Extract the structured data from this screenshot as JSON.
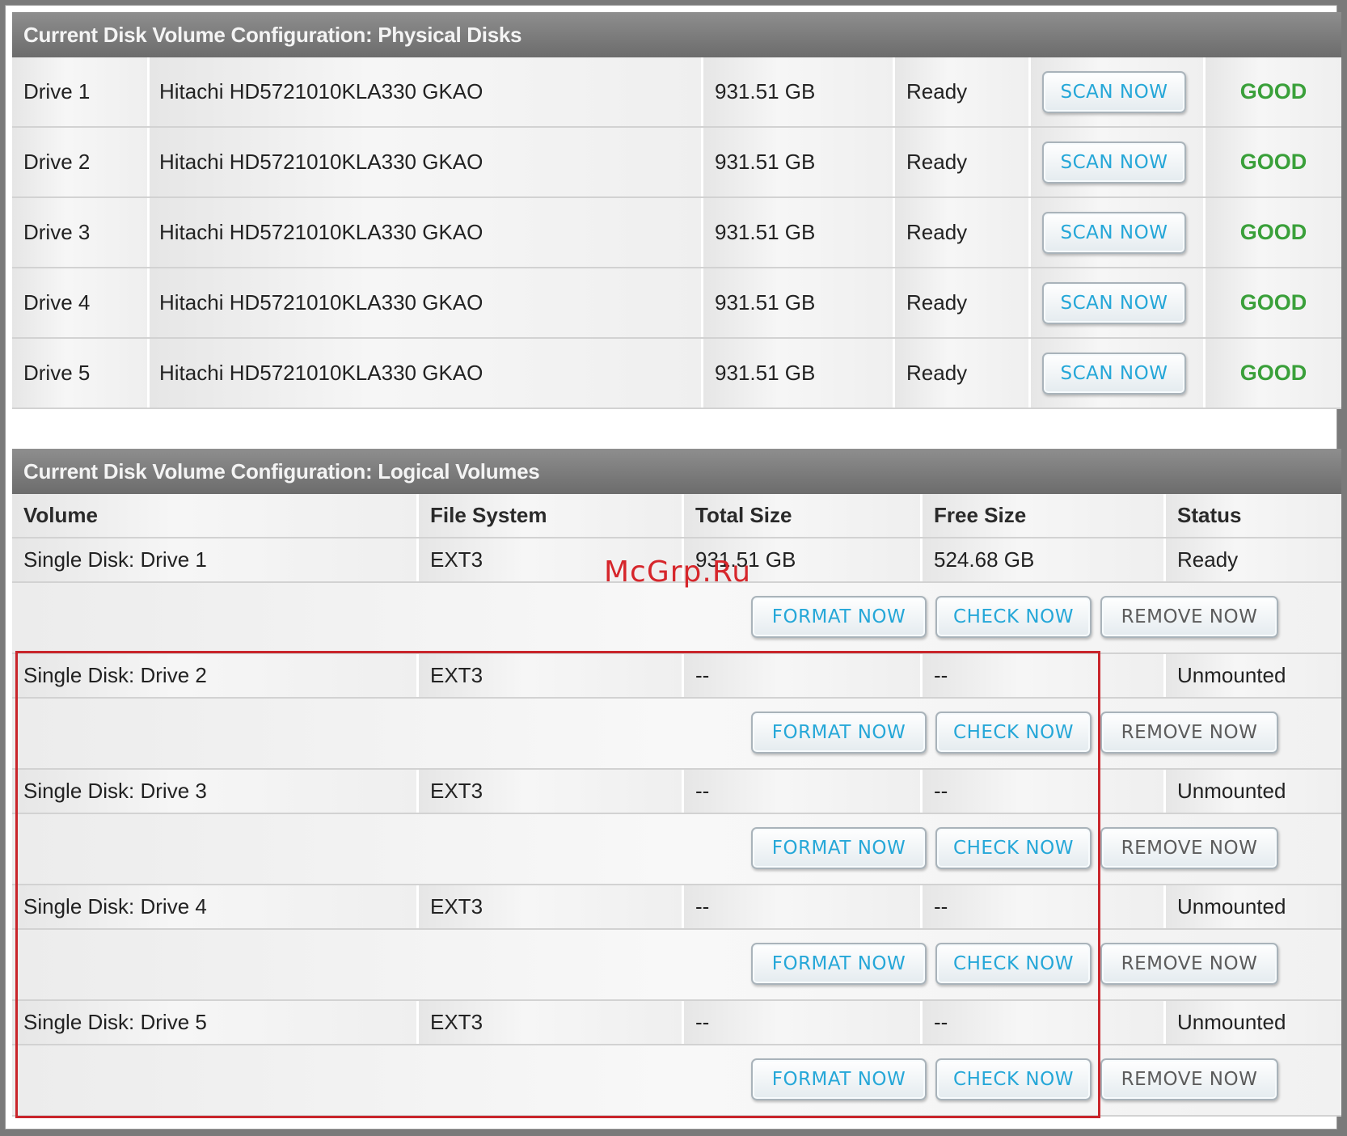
{
  "physical": {
    "title": "Current Disk Volume Configuration: Physical Disks",
    "drives": [
      {
        "name": "Drive 1",
        "model": "Hitachi HD5721010KLA330 GKAO",
        "size": "931.51 GB",
        "state": "Ready",
        "action": "SCAN NOW",
        "health": "GOOD"
      },
      {
        "name": "Drive 2",
        "model": "Hitachi HD5721010KLA330 GKAO",
        "size": "931.51 GB",
        "state": "Ready",
        "action": "SCAN NOW",
        "health": "GOOD"
      },
      {
        "name": "Drive 3",
        "model": "Hitachi HD5721010KLA330 GKAO",
        "size": "931.51 GB",
        "state": "Ready",
        "action": "SCAN NOW",
        "health": "GOOD"
      },
      {
        "name": "Drive 4",
        "model": "Hitachi HD5721010KLA330 GKAO",
        "size": "931.51 GB",
        "state": "Ready",
        "action": "SCAN NOW",
        "health": "GOOD"
      },
      {
        "name": "Drive 5",
        "model": "Hitachi HD5721010KLA330 GKAO",
        "size": "931.51 GB",
        "state": "Ready",
        "action": "SCAN NOW",
        "health": "GOOD"
      }
    ]
  },
  "logical": {
    "title": "Current Disk Volume Configuration: Logical Volumes",
    "headers": {
      "volume": "Volume",
      "fs": "File System",
      "total": "Total Size",
      "free": "Free Size",
      "status": "Status"
    },
    "volumes": [
      {
        "volume": "Single Disk: Drive 1",
        "fs": "EXT3",
        "total": "931.51 GB",
        "free": "524.68 GB",
        "status": "Ready"
      },
      {
        "volume": "Single Disk: Drive 2",
        "fs": "EXT3",
        "total": "--",
        "free": "--",
        "status": "Unmounted"
      },
      {
        "volume": "Single Disk: Drive 3",
        "fs": "EXT3",
        "total": "--",
        "free": "--",
        "status": "Unmounted"
      },
      {
        "volume": "Single Disk: Drive 4",
        "fs": "EXT3",
        "total": "--",
        "free": "--",
        "status": "Unmounted"
      },
      {
        "volume": "Single Disk: Drive 5",
        "fs": "EXT3",
        "total": "--",
        "free": "--",
        "status": "Unmounted"
      }
    ],
    "actions": {
      "format": "FORMAT NOW",
      "check": "CHECK NOW",
      "remove": "REMOVE NOW"
    }
  },
  "watermark": "McGrp.Ru",
  "colors": {
    "header_bg": "#7a7a7a",
    "good": "#3aa03a",
    "button_text": "#25a7d8",
    "highlight": "#c9252b"
  }
}
